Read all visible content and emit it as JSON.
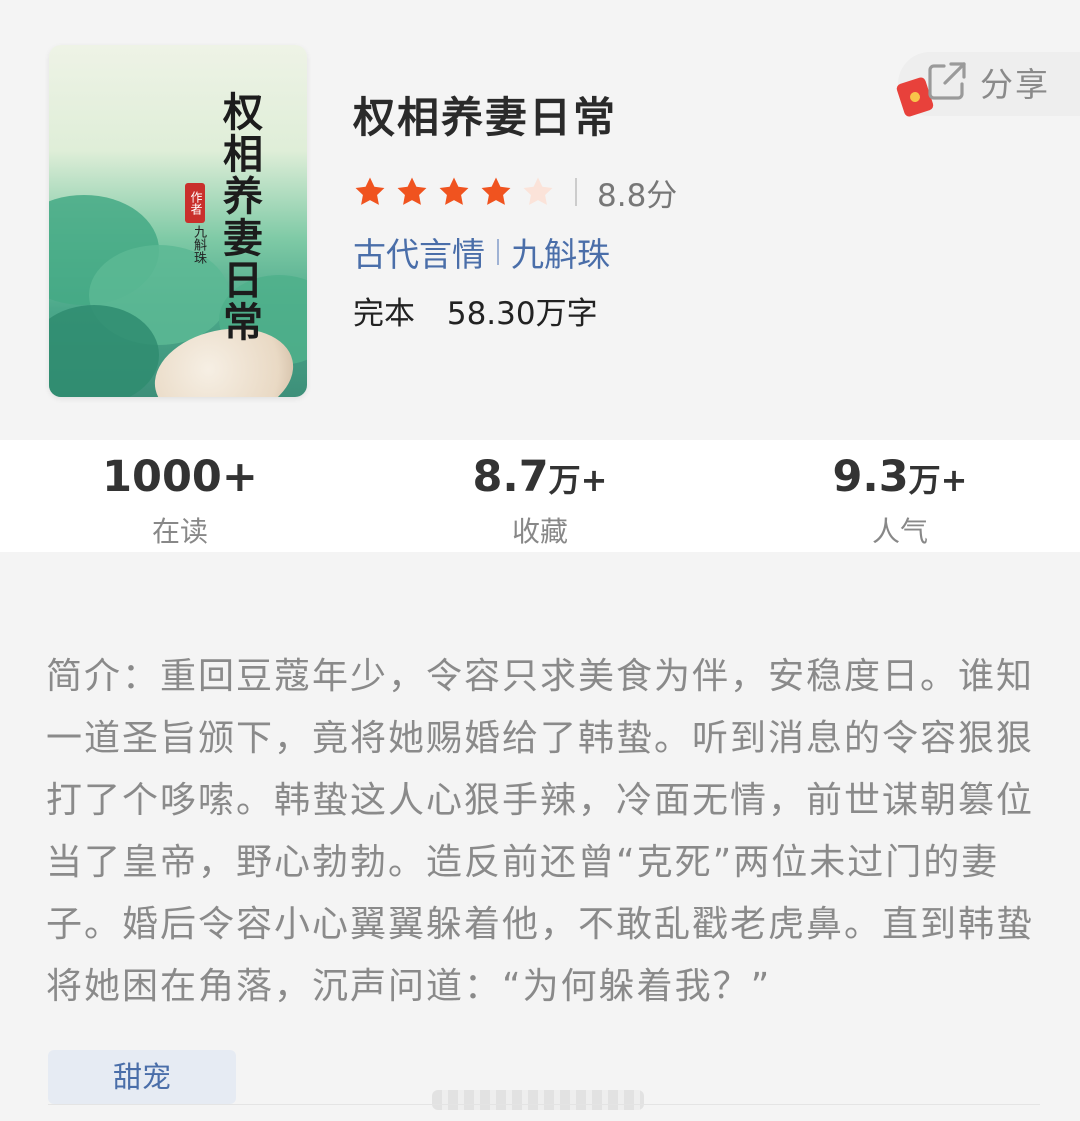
{
  "book": {
    "title": "权相养妻日常",
    "rating_stars": 4,
    "rating_max": 5,
    "score": "8.8分",
    "category": "古代言情",
    "author": "九斛珠",
    "status": "完本",
    "word_count": "58.30万字"
  },
  "cover": {
    "title_text": "权相养妻日常",
    "seal_text": "作者",
    "author_text": "九斛珠"
  },
  "share": {
    "label": "分享",
    "icon": "share-icon",
    "badge_icon": "red-packet-icon"
  },
  "stats": [
    {
      "value": "1000+",
      "unit": "",
      "label": "在读"
    },
    {
      "value": "8.7",
      "unit": "万+",
      "label": "收藏"
    },
    {
      "value": "9.3",
      "unit": "万+",
      "label": "人气"
    }
  ],
  "intro": {
    "text": "简介：重回豆蔻年少，令容只求美食为伴，安稳度日。谁知一道圣旨颁下，竟将她赐婚给了韩蛰。听到消息的令容狠狠打了个哆嗦。韩蛰这人心狠手辣，冷面无情，前世谋朝篡位当了皇帝，野心勃勃。造反前还曾“克死”两位未过门的妻子。婚后令容小心翼翼躲着他，不敢乱戳老虎鼻。直到韩蛰将她困在角落，沉声问道：“为何躲着我？”"
  },
  "tags": [
    "甜宠"
  ],
  "colors": {
    "accent": "#4a6ea9",
    "star_on": "#f0531f",
    "star_off": "#fbe3d9",
    "background": "#f4f4f4"
  }
}
